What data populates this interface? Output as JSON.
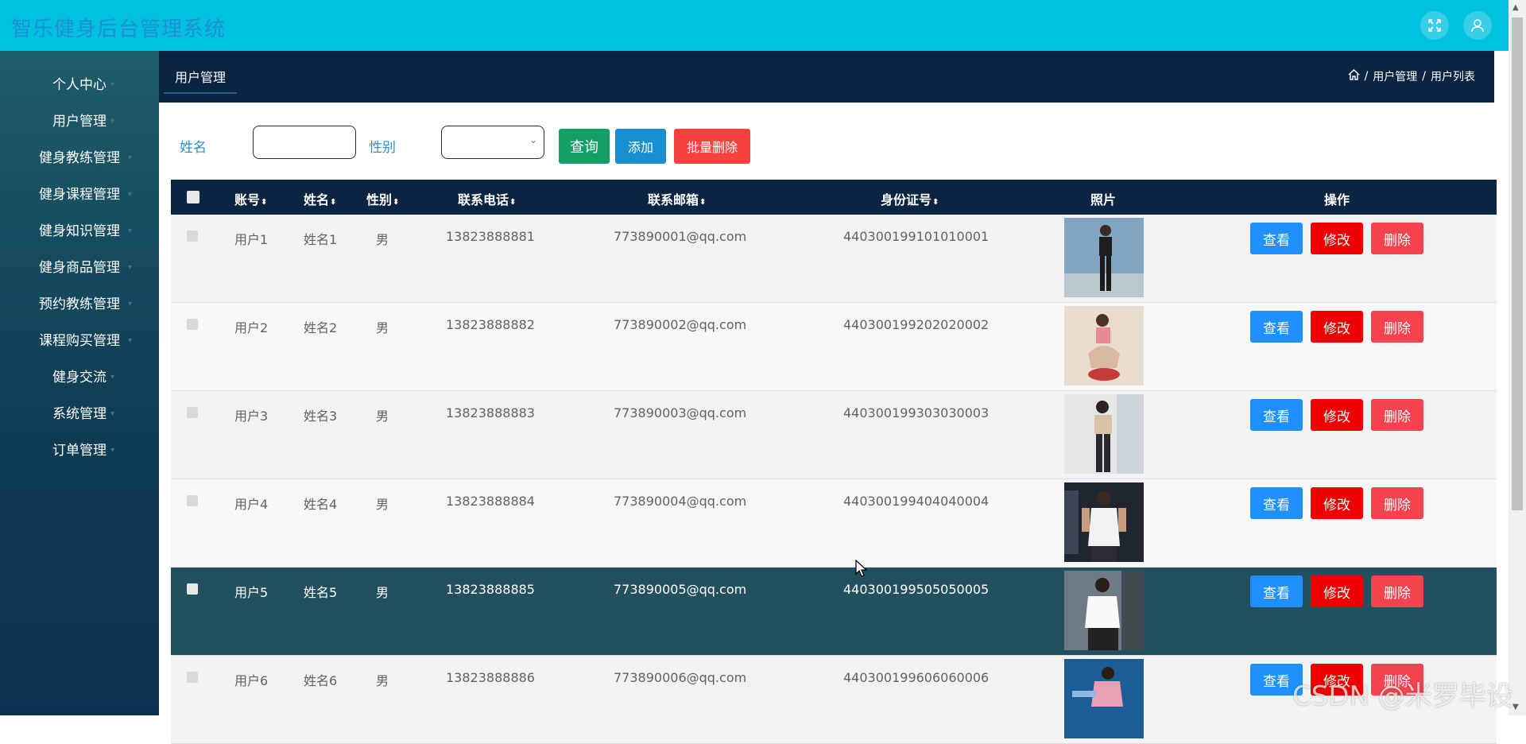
{
  "app": {
    "title": "智乐健身后台管理系统",
    "header_bg": "#00c1de"
  },
  "header_icons": [
    "fullscreen-icon",
    "user-icon"
  ],
  "sidebar": {
    "items": [
      {
        "label": "个人中心"
      },
      {
        "label": "用户管理"
      },
      {
        "label": "健身教练管理"
      },
      {
        "label": "健身课程管理"
      },
      {
        "label": "健身知识管理"
      },
      {
        "label": "健身商品管理"
      },
      {
        "label": "预约教练管理"
      },
      {
        "label": "课程购买管理"
      },
      {
        "label": "健身交流"
      },
      {
        "label": "系统管理"
      },
      {
        "label": "订单管理"
      }
    ]
  },
  "tabs": {
    "active": "用户管理"
  },
  "breadcrumb": {
    "home_icon": "home-icon",
    "sep": "/",
    "level1": "用户管理",
    "level2": "用户列表"
  },
  "search": {
    "name_label": "姓名",
    "name_value": "",
    "gender_label": "性别",
    "gender_value": "",
    "query_label": "查询",
    "add_label": "添加",
    "batch_delete_label": "批量删除"
  },
  "colors": {
    "query": "#13a067",
    "add": "#1a8fd0",
    "batch_delete": "#f5423f",
    "view": "#1e90ff",
    "edit": "#ee0000",
    "delete": "#f2434f",
    "table_header": "#0b2442"
  },
  "table": {
    "columns": [
      "账号",
      "姓名",
      "性别",
      "联系电话",
      "联系邮箱",
      "身份证号",
      "照片",
      "操作"
    ],
    "rows": [
      {
        "account": "用户1",
        "name": "姓名1",
        "gender": "男",
        "phone": "13823888881",
        "email": "773890001@qq.com",
        "idcard": "440300199101010001"
      },
      {
        "account": "用户2",
        "name": "姓名2",
        "gender": "男",
        "phone": "13823888882",
        "email": "773890002@qq.com",
        "idcard": "440300199202020002"
      },
      {
        "account": "用户3",
        "name": "姓名3",
        "gender": "男",
        "phone": "13823888883",
        "email": "773890003@qq.com",
        "idcard": "440300199303030003"
      },
      {
        "account": "用户4",
        "name": "姓名4",
        "gender": "男",
        "phone": "13823888884",
        "email": "773890004@qq.com",
        "idcard": "440300199404040004"
      },
      {
        "account": "用户5",
        "name": "姓名5",
        "gender": "男",
        "phone": "13823888885",
        "email": "773890005@qq.com",
        "idcard": "440300199505050005"
      },
      {
        "account": "用户6",
        "name": "姓名6",
        "gender": "男",
        "phone": "13823888886",
        "email": "773890006@qq.com",
        "idcard": "440300199606060006"
      }
    ],
    "actions": {
      "view": "查看",
      "edit": "修改",
      "delete": "删除"
    }
  },
  "watermark": "CSDN @米罗毕设"
}
